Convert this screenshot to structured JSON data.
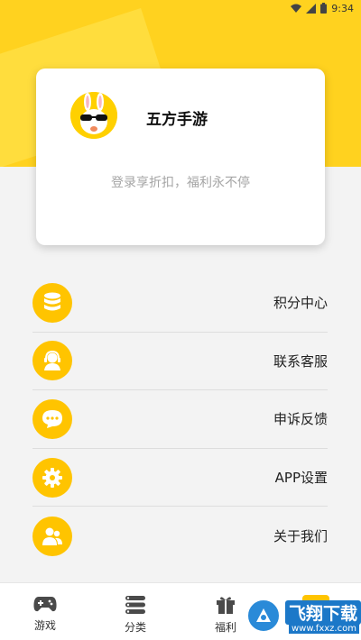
{
  "status_bar": {
    "time": "9:34"
  },
  "profile": {
    "app_name": "五方手游",
    "login_hint": "登录享折扣，福利永不停",
    "avatar_icon": "bunny-sunglasses-avatar"
  },
  "menu": {
    "items": [
      {
        "label": "积分中心",
        "icon": "database-icon"
      },
      {
        "label": "联系客服",
        "icon": "customer-service-icon"
      },
      {
        "label": "申诉反馈",
        "icon": "chat-bubble-icon"
      },
      {
        "label": "APP设置",
        "icon": "gear-icon"
      },
      {
        "label": "关于我们",
        "icon": "users-icon"
      }
    ]
  },
  "bottom_nav": {
    "items": [
      {
        "label": "游戏",
        "icon": "gamepad-icon"
      },
      {
        "label": "分类",
        "icon": "list-icon"
      },
      {
        "label": "福利",
        "icon": "gift-icon"
      },
      {
        "label": "",
        "icon": "mine-icon"
      }
    ]
  },
  "watermark": {
    "title": "飞翔下载",
    "url": "www.fxxz.com"
  },
  "colors": {
    "accent": "#ffc400",
    "header": "#ffd21f"
  }
}
